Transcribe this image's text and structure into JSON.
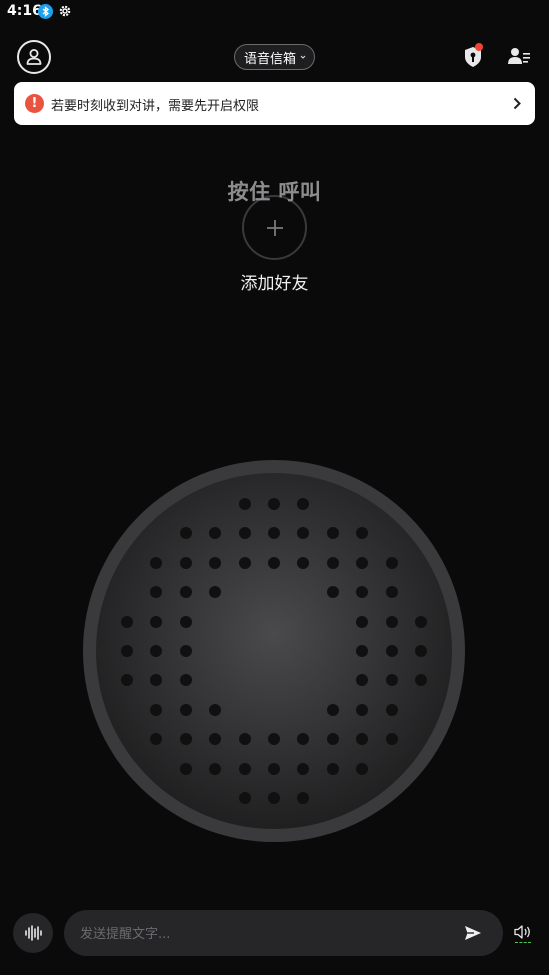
{
  "status_bar": {
    "time": "4:16",
    "icons": [
      "bluetooth-icon",
      "gear-icon"
    ]
  },
  "header": {
    "mode_select": {
      "label": "语音信箱"
    },
    "has_notification_dot": true,
    "icons": [
      "profile-icon",
      "shield-icon",
      "contacts-icon"
    ]
  },
  "permission_banner": {
    "text": "若要时刻收到对讲，需要先开启权限",
    "icon": "warning-icon",
    "accent": "#e8543f"
  },
  "add_friend": {
    "label": "添加好友",
    "icon": "plus-icon"
  },
  "talk_button": {
    "label": "按住 呼叫"
  },
  "message_bar": {
    "placeholder": "发送提醒文字...",
    "icons": [
      "voice-wave-icon",
      "send-icon",
      "speaker-icon"
    ]
  },
  "colors": {
    "background": "#0a0a0b",
    "banner_bg": "#ffffff",
    "notification_dot": "#f44336",
    "bluetooth": "#1ea0f0",
    "speaker_indicator": "#4cc24e"
  }
}
